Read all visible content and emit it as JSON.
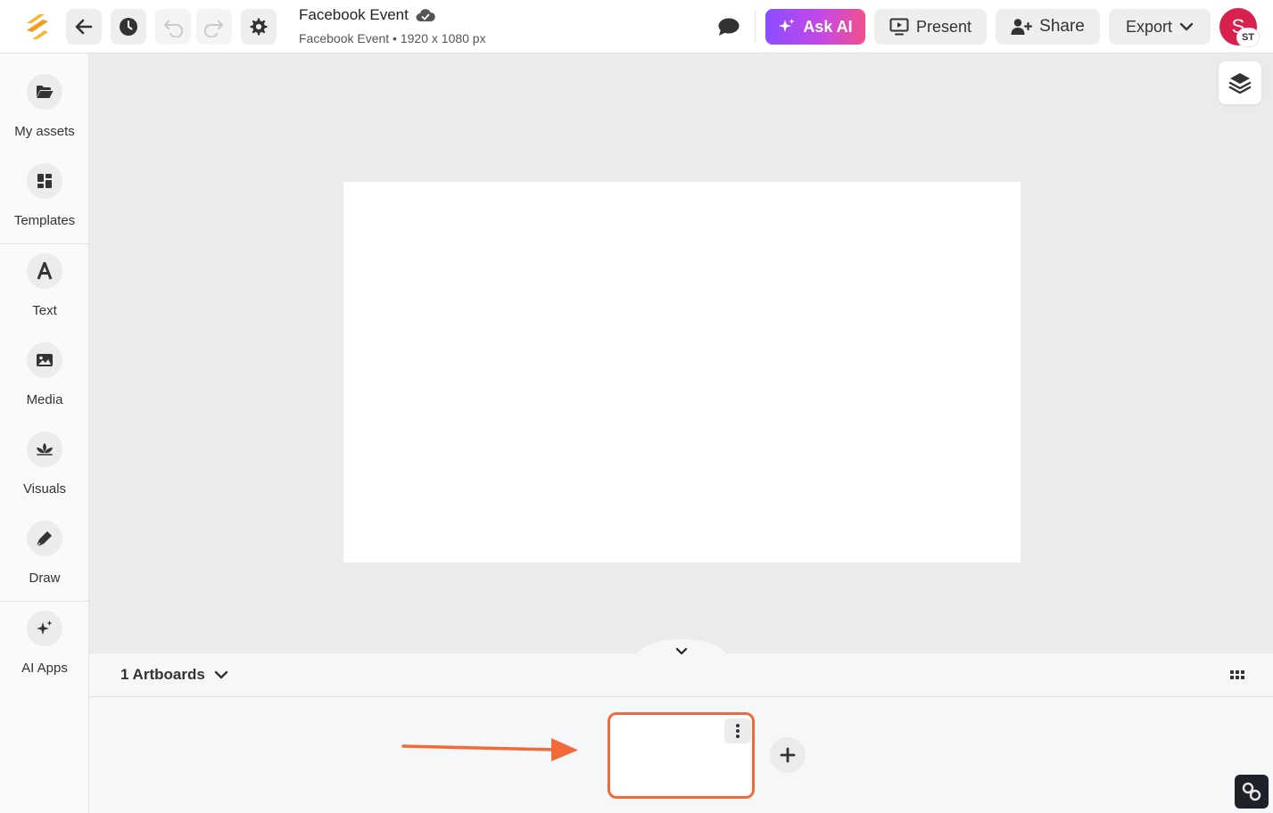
{
  "header": {
    "doc_title": "Facebook Event",
    "doc_subtitle": "Facebook Event • 1920 x 1080 px",
    "ask_ai_label": "Ask AI",
    "present_label": "Present",
    "share_label": "Share",
    "export_label": "Export",
    "avatar_initial": "S",
    "avatar_badge": "ST"
  },
  "sidebar": {
    "items": [
      {
        "label": "My assets",
        "icon": "folder-open-icon"
      },
      {
        "label": "Templates",
        "icon": "templates-icon"
      },
      {
        "label": "Text",
        "icon": "text-icon"
      },
      {
        "label": "Media",
        "icon": "image-icon"
      },
      {
        "label": "Visuals",
        "icon": "visuals-icon"
      },
      {
        "label": "Draw",
        "icon": "pen-icon"
      },
      {
        "label": "AI Apps",
        "icon": "sparkle-icon"
      }
    ]
  },
  "artboards": {
    "count_label": "1 Artboards"
  },
  "colors": {
    "accent_orange": "#f26a3a",
    "ask_ai_gradient_start": "#8a4dff",
    "ask_ai_gradient_end": "#f2508d",
    "avatar_bg": "#d9204f",
    "canvas_bg": "#ebebea"
  }
}
